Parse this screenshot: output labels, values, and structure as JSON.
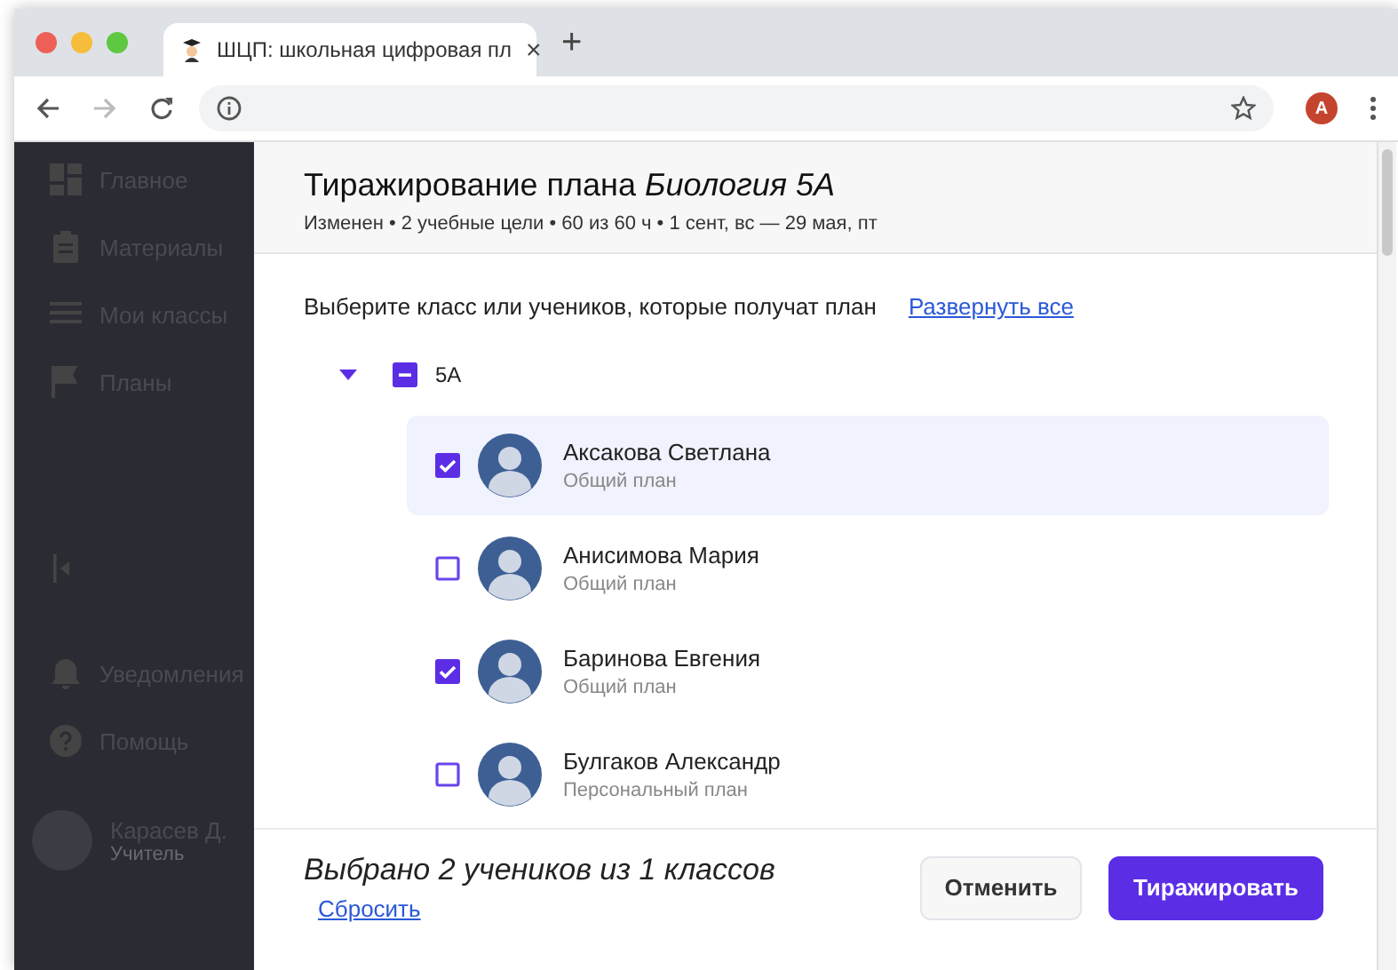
{
  "browser": {
    "tab_title": "ШЦП: школьная цифровая пл",
    "tab_close": "×",
    "new_tab": "+",
    "profile_initial": "A"
  },
  "sidebar": {
    "items": [
      {
        "label": "Главное"
      },
      {
        "label": "Материалы"
      },
      {
        "label": "Мои классы"
      },
      {
        "label": "Планы"
      }
    ],
    "bottom_items": [
      {
        "label": "Уведомления"
      },
      {
        "label": "Помощь"
      }
    ],
    "user": {
      "name": "Карасев Д.",
      "role": "Учитель"
    }
  },
  "dialog": {
    "title": "Тиражирование плана",
    "title_subject": "Биология 5А",
    "subtitle": "Изменен • 2 учебные цели • 60 из 60 ч • 1 сент, вс — 29 мая, пт",
    "instruction": "Выберите класс или учеников, которые получат план",
    "expand_link": "Развернуть все",
    "groups": [
      {
        "label": "5А",
        "expanded": true,
        "checked": false,
        "indeterminate": true,
        "children": [
          {
            "name": "Аксакова Светлана",
            "plan": "Общий план",
            "checked": true,
            "selected": true
          },
          {
            "name": "Анисимова Мария",
            "plan": "Общий план",
            "checked": false,
            "selected": false
          },
          {
            "name": "Баринова Евгения",
            "plan": "Общий план",
            "checked": true,
            "selected": false
          },
          {
            "name": "Булгаков Александр",
            "plan": "Персональный план",
            "checked": false,
            "selected": false
          }
        ]
      }
    ],
    "footer": {
      "summary": "Выбрано 2 учеников из 1 классов",
      "reset_link": "Сбросить",
      "buttons": [
        {
          "label": "Отменить",
          "kind": "secondary"
        },
        {
          "label": "Тиражировать",
          "kind": "primary"
        }
      ]
    }
  }
}
